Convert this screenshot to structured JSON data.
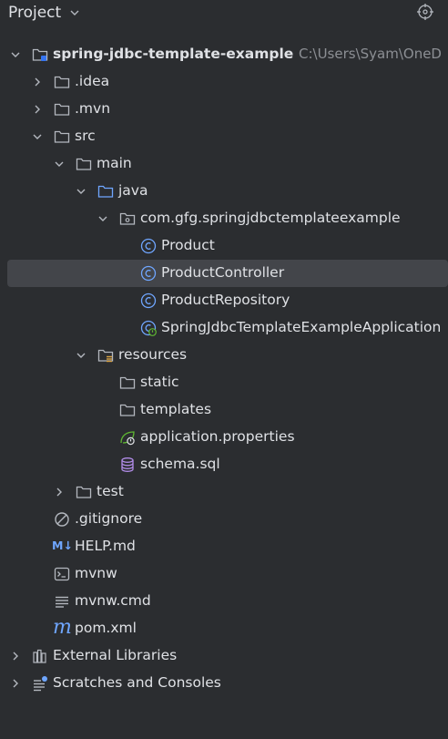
{
  "panel": {
    "title": "Project"
  },
  "tree": {
    "root": {
      "name": "spring-jdbc-template-example",
      "path": "C:\\Users\\Syam\\OneD"
    },
    "idea": ".idea",
    "mvn": ".mvn",
    "src": "src",
    "main": "main",
    "java": "java",
    "package": "com.gfg.springjdbctemplateexample",
    "product": "Product",
    "product_controller": "ProductController",
    "product_repository": "ProductRepository",
    "application_class": "SpringJdbcTemplateExampleApplication",
    "resources": "resources",
    "static": "static",
    "templates": "templates",
    "application_properties": "application.properties",
    "schema": "schema.sql",
    "test": "test",
    "gitignore": ".gitignore",
    "help_md": "HELP.md",
    "mvnw": "mvnw",
    "mvnw_cmd": "mvnw.cmd",
    "pom": "pom.xml",
    "external_libraries": "External Libraries",
    "scratches": "Scratches and Consoles"
  },
  "icons": {
    "md_badge": "M↓",
    "maven": "m"
  },
  "colors": {
    "background": "#2b2d30",
    "selected_row": "#43454a",
    "text": "#dfe1e5",
    "path_text": "#8c8f94",
    "accent_blue": "#6fa6ff"
  }
}
